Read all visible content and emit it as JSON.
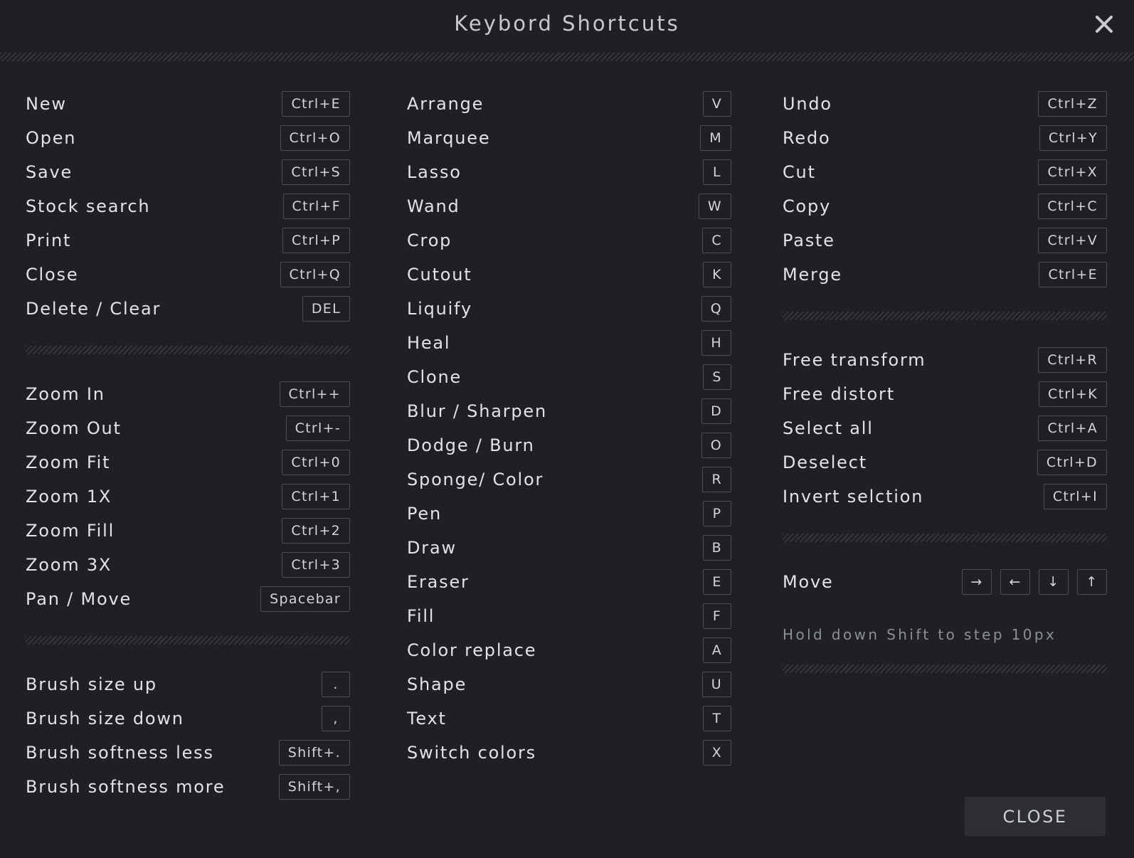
{
  "dialog": {
    "title": "Keybord Shortcuts",
    "close_button_label": "CLOSE",
    "hint": "Hold down Shift to step 10px"
  },
  "file_group": [
    {
      "label": "New",
      "key": "Ctrl+E"
    },
    {
      "label": "Open",
      "key": "Ctrl+O"
    },
    {
      "label": "Save",
      "key": "Ctrl+S"
    },
    {
      "label": "Stock search",
      "key": "Ctrl+F"
    },
    {
      "label": "Print",
      "key": "Ctrl+P"
    },
    {
      "label": "Close",
      "key": "Ctrl+Q"
    },
    {
      "label": "Delete / Clear",
      "key": "DEL"
    }
  ],
  "zoom_group": [
    {
      "label": "Zoom In",
      "key": "Ctrl++"
    },
    {
      "label": "Zoom Out",
      "key": "Ctrl+-"
    },
    {
      "label": "Zoom Fit",
      "key": "Ctrl+0"
    },
    {
      "label": "Zoom 1X",
      "key": "Ctrl+1"
    },
    {
      "label": "Zoom Fill",
      "key": "Ctrl+2"
    },
    {
      "label": "Zoom 3X",
      "key": "Ctrl+3"
    },
    {
      "label": "Pan / Move",
      "key": "Spacebar"
    }
  ],
  "brush_group": [
    {
      "label": "Brush size up",
      "key": "."
    },
    {
      "label": "Brush size down",
      "key": ","
    },
    {
      "label": "Brush softness less",
      "key": "Shift+."
    },
    {
      "label": "Brush softness more",
      "key": "Shift+,"
    }
  ],
  "tools_group": [
    {
      "label": "Arrange",
      "key": "V"
    },
    {
      "label": "Marquee",
      "key": "M"
    },
    {
      "label": "Lasso",
      "key": "L"
    },
    {
      "label": "Wand",
      "key": "W"
    },
    {
      "label": "Crop",
      "key": "C"
    },
    {
      "label": "Cutout",
      "key": "K"
    },
    {
      "label": "Liquify",
      "key": "Q"
    },
    {
      "label": "Heal",
      "key": "H"
    },
    {
      "label": "Clone",
      "key": "S"
    },
    {
      "label": "Blur / Sharpen",
      "key": "D"
    },
    {
      "label": "Dodge / Burn",
      "key": "O"
    },
    {
      "label": "Sponge/ Color",
      "key": "R"
    },
    {
      "label": "Pen",
      "key": "P"
    },
    {
      "label": "Draw",
      "key": "B"
    },
    {
      "label": "Eraser",
      "key": "E"
    },
    {
      "label": "Fill",
      "key": "F"
    },
    {
      "label": "Color replace",
      "key": "A"
    },
    {
      "label": "Shape",
      "key": "U"
    },
    {
      "label": "Text",
      "key": "T"
    },
    {
      "label": "Switch colors",
      "key": "X"
    }
  ],
  "edit_group": [
    {
      "label": "Undo",
      "key": "Ctrl+Z"
    },
    {
      "label": "Redo",
      "key": "Ctrl+Y"
    },
    {
      "label": "Cut",
      "key": "Ctrl+X"
    },
    {
      "label": "Copy",
      "key": "Ctrl+C"
    },
    {
      "label": "Paste",
      "key": "Ctrl+V"
    },
    {
      "label": "Merge",
      "key": "Ctrl+E"
    }
  ],
  "transform_group": [
    {
      "label": "Free transform",
      "key": "Ctrl+R"
    },
    {
      "label": "Free distort",
      "key": "Ctrl+K"
    },
    {
      "label": "Select all",
      "key": "Ctrl+A"
    },
    {
      "label": "Deselect",
      "key": "Ctrl+D"
    },
    {
      "label": "Invert selction",
      "key": "Ctrl+I"
    }
  ],
  "move": {
    "label": "Move",
    "keys": [
      "→",
      "←",
      "↓",
      "↑"
    ]
  },
  "colors": {
    "background": "#1f2023",
    "text": "#e1e3e6",
    "key_border": "#4a4c51",
    "hint_text": "#8d9094",
    "close_button_bg": "#2e2f33"
  }
}
